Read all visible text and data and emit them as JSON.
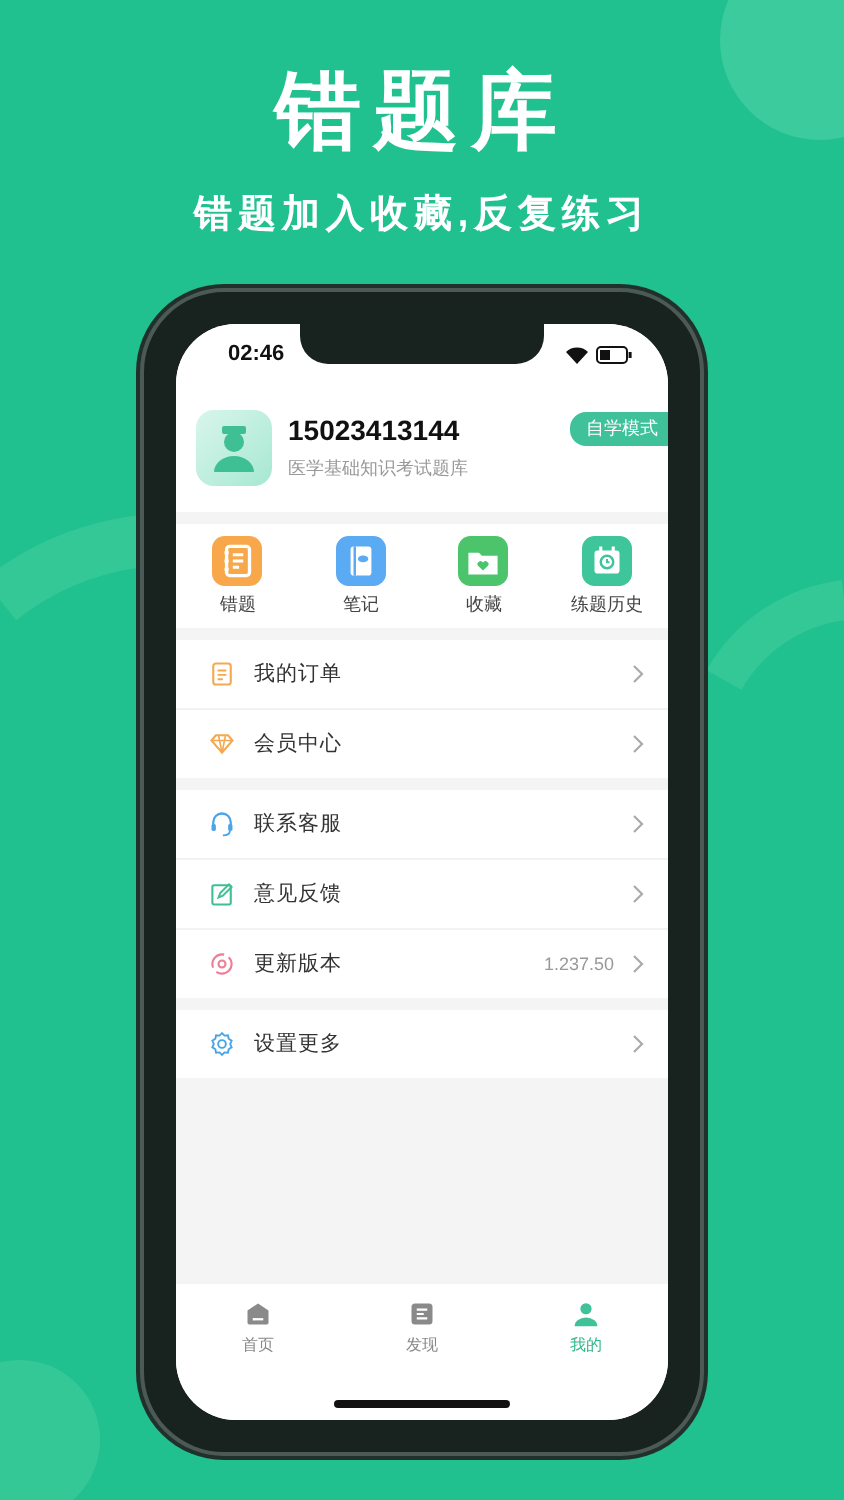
{
  "headline": "错题库",
  "subtitle": "错题加入收藏,反复练习",
  "status_bar": {
    "time": "02:46"
  },
  "profile": {
    "phone": "15023413144",
    "subtitle": "医学基础知识考试题库",
    "mode_badge": "自学模式"
  },
  "shortcuts": [
    {
      "label": "错题",
      "kind": "notebook",
      "color": "#f8a84a"
    },
    {
      "label": "笔记",
      "kind": "note",
      "color": "#5aaaf4"
    },
    {
      "label": "收藏",
      "kind": "favorite",
      "color": "#4cc46b"
    },
    {
      "label": "练题历史",
      "kind": "history",
      "color": "#3fc59a"
    }
  ],
  "menu_groups": [
    [
      {
        "label": "我的订单",
        "kind": "order"
      },
      {
        "label": "会员中心",
        "kind": "member"
      }
    ],
    [
      {
        "label": "联系客服",
        "kind": "service"
      },
      {
        "label": "意见反馈",
        "kind": "feedback"
      },
      {
        "label": "更新版本",
        "kind": "update",
        "value": "1.237.50"
      }
    ],
    [
      {
        "label": "设置更多",
        "kind": "settings"
      }
    ]
  ],
  "tab_bar": [
    {
      "label": "首页",
      "kind": "home",
      "selected": false
    },
    {
      "label": "发现",
      "kind": "discover",
      "selected": false
    },
    {
      "label": "我的",
      "kind": "mine",
      "selected": true
    }
  ]
}
